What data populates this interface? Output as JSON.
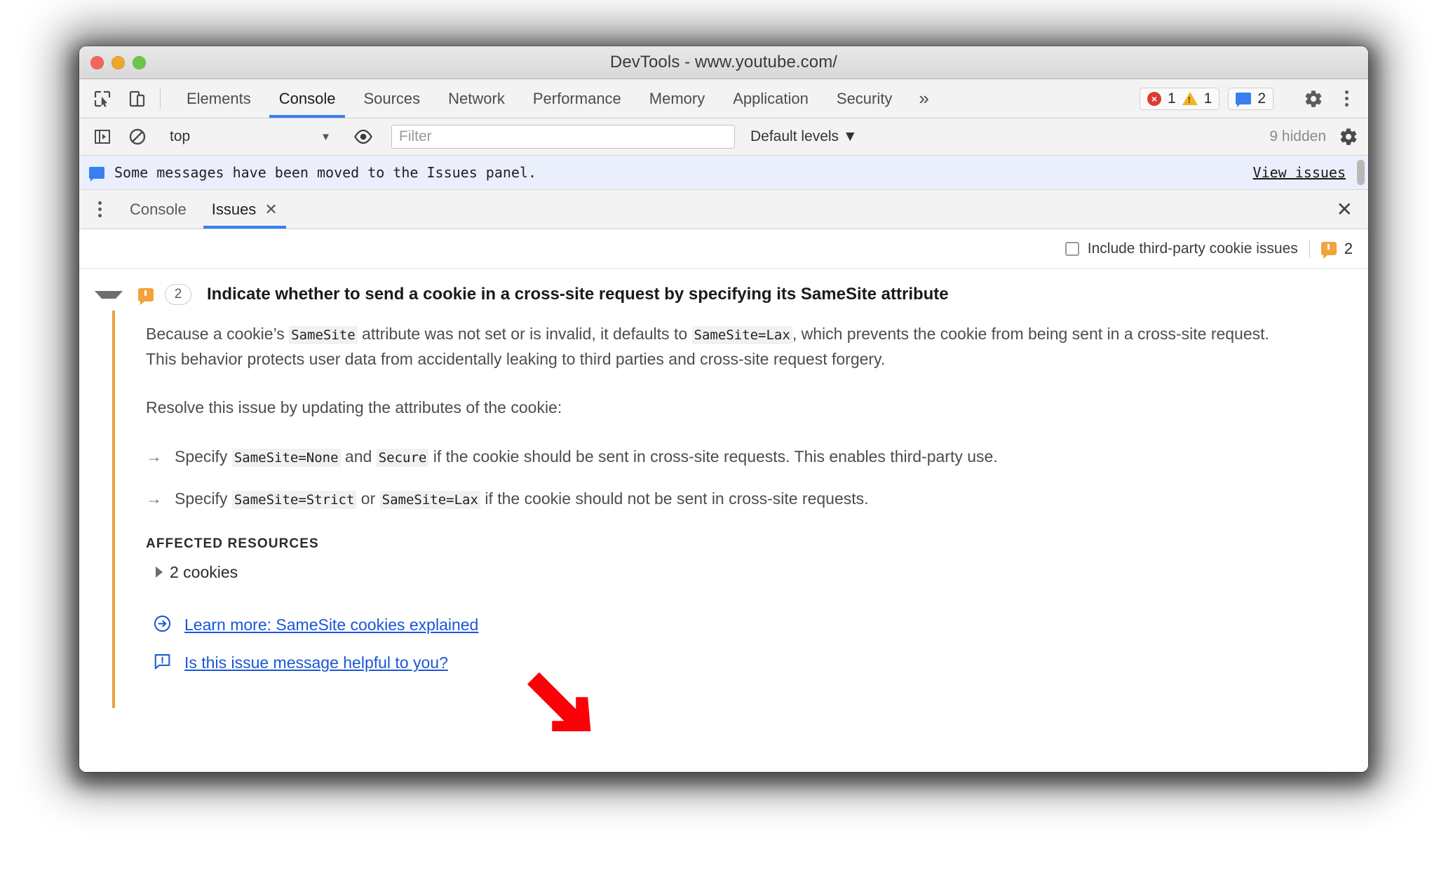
{
  "window": {
    "title": "DevTools - www.youtube.com/",
    "traffic_lights": [
      "close-red",
      "minimize-yellow",
      "maximize-green"
    ]
  },
  "panel_bar": {
    "inspect_icon": "inspect-element-icon",
    "device_icon": "device-toolbar-icon",
    "tabs": [
      {
        "label": "Elements",
        "active": false
      },
      {
        "label": "Console",
        "active": true
      },
      {
        "label": "Sources",
        "active": false
      },
      {
        "label": "Network",
        "active": false
      },
      {
        "label": "Performance",
        "active": false
      },
      {
        "label": "Memory",
        "active": false
      },
      {
        "label": "Application",
        "active": false
      },
      {
        "label": "Security",
        "active": false
      }
    ],
    "more_tabs_label": "»",
    "error_count": "1",
    "warning_count": "1",
    "message_count": "2",
    "settings_icon": "gear-icon",
    "menu_icon": "kebab-menu-icon"
  },
  "console_toolbar": {
    "sidebar_toggle_icon": "console-sidebar-icon",
    "clear_icon": "clear-console-icon",
    "context_value": "top",
    "eye_icon": "live-expression-icon",
    "filter_placeholder": "Filter",
    "filter_value": "",
    "levels_label": "Default levels",
    "hidden_label": "9 hidden",
    "settings_icon": "gear-icon"
  },
  "banner": {
    "icon": "issues-message-icon",
    "text": "Some messages have been moved to the Issues panel.",
    "link": "View issues"
  },
  "drawer": {
    "menu_icon": "kebab-menu-icon",
    "tabs": [
      {
        "label": "Console",
        "active": false,
        "closable": false
      },
      {
        "label": "Issues",
        "active": true,
        "closable": true
      }
    ],
    "close_icon": "close-icon"
  },
  "issues_filter": {
    "checkbox_label": "Include third-party cookie issues",
    "checkbox_checked": false,
    "issue_icon": "issue-warning-icon",
    "issue_count": "2"
  },
  "issue": {
    "expanded": true,
    "icon": "issue-warning-icon",
    "count": "2",
    "title": "Indicate whether to send a cookie in a cross-site request by specifying its SameSite attribute",
    "paragraph1": {
      "part1": "Because a cookie’s ",
      "code1": "SameSite",
      "part2": " attribute was not set or is invalid, it defaults to ",
      "code2": "SameSite=Lax",
      "part3": ", which prevents the cookie from being sent in a cross-site request. This behavior protects user data from accidentally leaking to third parties and cross-site request forgery."
    },
    "paragraph2": "Resolve this issue by updating the attributes of the cookie:",
    "bullets": [
      {
        "arrow": "→",
        "part1": "Specify ",
        "code1": "SameSite=None",
        "part2": " and ",
        "code2": "Secure",
        "part3": " if the cookie should be sent in cross-site requests. This enables third-party use."
      },
      {
        "arrow": "→",
        "part1": "Specify ",
        "code1": "SameSite=Strict",
        "part2": " or ",
        "code2": "SameSite=Lax",
        "part3": " if the cookie should not be sent in cross-site requests."
      }
    ],
    "affected_resources_title": "AFFECTED RESOURCES",
    "resource_label": "2 cookies",
    "links": [
      {
        "icon": "external-link-arrow-icon",
        "label": "Learn more: SameSite cookies explained"
      },
      {
        "icon": "feedback-icon",
        "label": "Is this issue message helpful to you?"
      }
    ]
  },
  "annotation": {
    "arrow_color": "#fb0007",
    "arrow_name": "red-pointer-arrow"
  },
  "colors": {
    "accent_blue": "#3a7ff0",
    "link_blue": "#1a56d6",
    "issue_orange": "#e8a33d",
    "error_red": "#dc3b30",
    "banner_bg": "#eaeffb"
  }
}
